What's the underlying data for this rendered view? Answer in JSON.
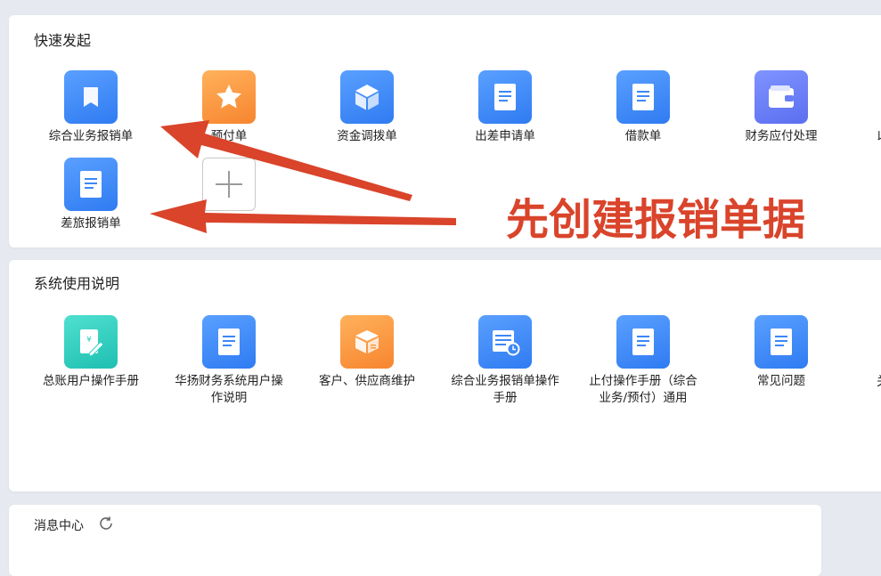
{
  "quick_launch": {
    "title": "快速发起",
    "tiles": [
      {
        "label": "综合业务报销单",
        "icon": "bookmark-icon",
        "color": "#3d88f7"
      },
      {
        "label": "预付单",
        "icon": "star-icon",
        "color": "#f99640"
      },
      {
        "label": "资金调拨单",
        "icon": "cube-icon",
        "color": "#3d88f7"
      },
      {
        "label": "出差申请单",
        "icon": "document-icon",
        "color": "#3d88f7"
      },
      {
        "label": "借款单",
        "icon": "document-icon",
        "color": "#3d88f7"
      },
      {
        "label": "财务应付处理",
        "icon": "wallet-icon",
        "color": "#6a7ff5"
      },
      {
        "label": "差旅报销单",
        "icon": "document-icon",
        "color": "#3d88f7"
      }
    ],
    "add_button_icon": "plus-icon",
    "edge_char": "以"
  },
  "annotation": {
    "text": "先创建报销单据",
    "color": "#d9442b"
  },
  "guide": {
    "title": "系统使用说明",
    "tiles": [
      {
        "label": "总账用户操作手册",
        "icon": "receipt-yen-icon",
        "color": "#2fd0c2"
      },
      {
        "label": "华扬财务系统用户操作说明",
        "icon": "document-icon",
        "color": "#3d88f7"
      },
      {
        "label": "客户、供应商维护",
        "icon": "package-icon",
        "color": "#f99640"
      },
      {
        "label": "综合业务报销单操作手册",
        "icon": "table-clock-icon",
        "color": "#3d88f7"
      },
      {
        "label": "止付操作手册（综合业务/预付）通用",
        "icon": "document-icon",
        "color": "#3d88f7"
      },
      {
        "label": "常见问题",
        "icon": "document-icon",
        "color": "#3d88f7"
      }
    ],
    "edge_char": "关"
  },
  "messages": {
    "title": "消息中心",
    "refresh_icon": "refresh-icon"
  }
}
